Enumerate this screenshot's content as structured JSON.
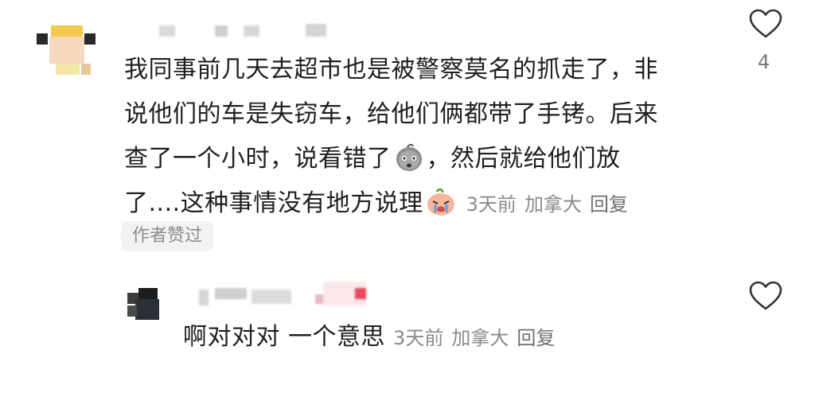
{
  "comment": {
    "lines": [
      "我同事前几天去超市也是被警察莫名的抓走了，非",
      "说他们的车是失窃车，给他们俩都带了手铐。后来",
      "查了一个小时，说看错了",
      "，然后就给他们放",
      "了....这种事情没有地方说理"
    ],
    "time": "3天前",
    "location": "加拿大",
    "reply_label": "回复",
    "like_count": "4",
    "author_badge": "作者赞过"
  },
  "reply": {
    "text": "啊对对对 一个意思",
    "time": "3天前",
    "location": "加拿大",
    "reply_label": "回复"
  },
  "icons": {
    "like": "heart-outline-icon",
    "emoji_1": "peach-shocked-emoji",
    "emoji_2": "crying-emoji"
  },
  "colors": {
    "text": "#1f1f1f",
    "meta": "#8a8a8a",
    "badge_bg": "#f2f2f2",
    "heart": "#333333"
  }
}
